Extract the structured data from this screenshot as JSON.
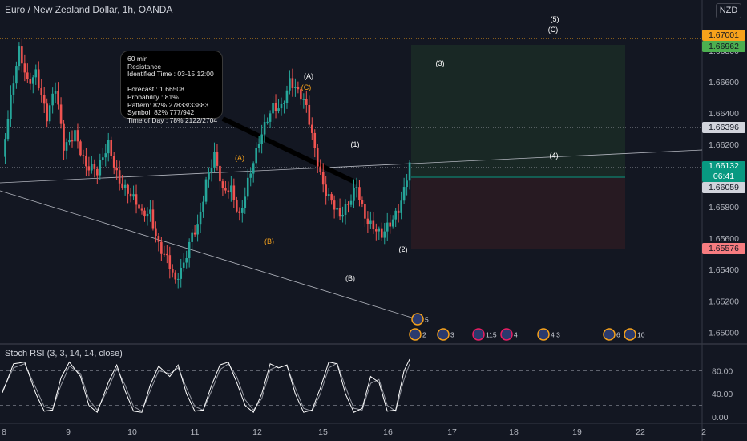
{
  "header": {
    "title": "Euro / New Zealand Dollar, 1h, OANDA",
    "currency": "NZD"
  },
  "tooltip": {
    "lines": [
      "60 min",
      "Resistance",
      "Identified Time : 03-15 12:00",
      "",
      "Forecast : 1.66508",
      "Probability : 81%",
      "Pattern: 82% 27833/33883",
      "Symbol: 82% 777/942",
      "Time of Day : 78% 2122/2704"
    ]
  },
  "price_labels": {
    "orange": "1.67001",
    "green": "1.66962",
    "grey1": "1.66396",
    "current": "1.66132",
    "countdown": "06:41",
    "grey2": "1.66059",
    "red": "1.65576"
  },
  "indicator": {
    "label": "Stoch RSI (3, 3, 14, 14, close)"
  },
  "colors": {
    "background": "#131722",
    "up": "#26a69a",
    "down": "#ef5350",
    "wave_orange": "#f7a21b",
    "wave_white": "#ffffff",
    "target_green": "#1b2a26",
    "target_red": "#2a1b22"
  },
  "chart_data": [
    {
      "type": "candlestick",
      "title": "Euro / New Zealand Dollar, 1h, OANDA",
      "x_ticks": [
        "8",
        "9",
        "10",
        "11",
        "12",
        "15",
        "16",
        "17",
        "18",
        "19",
        "22",
        "2"
      ],
      "y_ticks": [
        "1.66800",
        "1.66600",
        "1.66400",
        "1.66200",
        "1.66000",
        "1.65800",
        "1.65600",
        "1.65400",
        "1.65200",
        "1.65000"
      ],
      "ylim": [
        1.6493,
        1.6705
      ],
      "series": [
        {
          "name": "candles",
          "segments": [
            [
              0,
              1.6612
            ],
            [
              3,
              1.6645
            ],
            [
              6,
              1.6678
            ],
            [
              9,
              1.6662
            ],
            [
              12,
              1.667
            ],
            [
              16,
              1.6635
            ],
            [
              19,
              1.6652
            ],
            [
              22,
              1.6618
            ],
            [
              26,
              1.6632
            ],
            [
              30,
              1.6605
            ],
            [
              34,
              1.6598
            ],
            [
              38,
              1.6622
            ],
            [
              42,
              1.66
            ],
            [
              46,
              1.6585
            ],
            [
              50,
              1.6572
            ],
            [
              53,
              1.6578
            ],
            [
              56,
              1.656
            ],
            [
              59,
              1.6548
            ],
            [
              62,
              1.6528
            ],
            [
              65,
              1.654
            ],
            [
              68,
              1.6565
            ],
            [
              70,
              1.6572
            ],
            [
              73,
              1.6598
            ],
            [
              76,
              1.661
            ],
            [
              79,
              1.6586
            ],
            [
              82,
              1.6592
            ],
            [
              85,
              1.6578
            ],
            [
              88,
              1.6598
            ],
            [
              91,
              1.6612
            ],
            [
              94,
              1.6628
            ],
            [
              97,
              1.6645
            ],
            [
              100,
              1.6648
            ],
            [
              103,
              1.6662
            ],
            [
              106,
              1.665
            ],
            [
              109,
              1.664
            ],
            [
              112,
              1.6618
            ],
            [
              115,
              1.6598
            ],
            [
              118,
              1.6585
            ],
            [
              121,
              1.657
            ],
            [
              124,
              1.6578
            ],
            [
              127,
              1.6595
            ],
            [
              130,
              1.6578
            ],
            [
              133,
              1.6568
            ],
            [
              136,
              1.6558
            ],
            [
              139,
              1.6566
            ],
            [
              142,
              1.658
            ],
            [
              144,
              1.6595
            ],
            [
              146,
              1.6612
            ]
          ]
        }
      ],
      "wave_labels": [
        {
          "text": "(5)",
          "color": "white"
        },
        {
          "text": "(C)",
          "color": "white"
        },
        {
          "text": "(A)",
          "color": "white"
        },
        {
          "text": "(C)",
          "color": "orange"
        },
        {
          "text": "(3)",
          "color": "white"
        },
        {
          "text": "(A)",
          "color": "orange"
        },
        {
          "text": "(1)",
          "color": "white"
        },
        {
          "text": "(4)",
          "color": "white"
        },
        {
          "text": "(B)",
          "color": "orange"
        },
        {
          "text": "(2)",
          "color": "white"
        },
        {
          "text": "(B)",
          "color": "white"
        }
      ],
      "event_badges": [
        "5",
        "2",
        "3",
        "115",
        "4",
        "4 3",
        "6",
        "10"
      ]
    },
    {
      "type": "line",
      "title": "Stoch RSI (3, 3, 14, 14, close)",
      "y_ticks": [
        "80.00",
        "40.00",
        "0.00"
      ],
      "ylim": [
        0,
        100
      ],
      "series": [
        {
          "name": "K",
          "segments": [
            [
              0,
              42
            ],
            [
              4,
              92
            ],
            [
              8,
              95
            ],
            [
              12,
              40
            ],
            [
              15,
              10
            ],
            [
              18,
              12
            ],
            [
              21,
              68
            ],
            [
              24,
              95
            ],
            [
              28,
              70
            ],
            [
              31,
              20
            ],
            [
              34,
              8
            ],
            [
              38,
              60
            ],
            [
              41,
              90
            ],
            [
              44,
              45
            ],
            [
              47,
              10
            ],
            [
              50,
              8
            ],
            [
              53,
              55
            ],
            [
              56,
              88
            ],
            [
              60,
              70
            ],
            [
              63,
              90
            ],
            [
              66,
              40
            ],
            [
              69,
              10
            ],
            [
              72,
              12
            ],
            [
              75,
              55
            ],
            [
              78,
              90
            ],
            [
              81,
              95
            ],
            [
              84,
              60
            ],
            [
              87,
              20
            ],
            [
              90,
              8
            ],
            [
              93,
              40
            ],
            [
              96,
              92
            ],
            [
              99,
              85
            ],
            [
              102,
              90
            ],
            [
              105,
              40
            ],
            [
              108,
              8
            ],
            [
              111,
              12
            ],
            [
              114,
              50
            ],
            [
              117,
              95
            ],
            [
              120,
              92
            ],
            [
              123,
              40
            ],
            [
              126,
              8
            ],
            [
              129,
              15
            ],
            [
              132,
              70
            ],
            [
              135,
              60
            ],
            [
              138,
              10
            ],
            [
              141,
              12
            ],
            [
              144,
              80
            ],
            [
              146,
              100
            ]
          ]
        },
        {
          "name": "D",
          "segments": [
            [
              0,
              45
            ],
            [
              4,
              85
            ],
            [
              8,
              92
            ],
            [
              12,
              50
            ],
            [
              15,
              18
            ],
            [
              18,
              14
            ],
            [
              21,
              55
            ],
            [
              24,
              88
            ],
            [
              28,
              75
            ],
            [
              31,
              30
            ],
            [
              34,
              12
            ],
            [
              38,
              50
            ],
            [
              41,
              84
            ],
            [
              44,
              55
            ],
            [
              47,
              18
            ],
            [
              50,
              10
            ],
            [
              53,
              45
            ],
            [
              56,
              80
            ],
            [
              60,
              75
            ],
            [
              63,
              85
            ],
            [
              66,
              50
            ],
            [
              69,
              18
            ],
            [
              72,
              12
            ],
            [
              75,
              45
            ],
            [
              78,
              82
            ],
            [
              81,
              92
            ],
            [
              84,
              70
            ],
            [
              87,
              30
            ],
            [
              90,
              12
            ],
            [
              93,
              32
            ],
            [
              96,
              82
            ],
            [
              99,
              88
            ],
            [
              102,
              88
            ],
            [
              105,
              50
            ],
            [
              108,
              15
            ],
            [
              111,
              10
            ],
            [
              114,
              40
            ],
            [
              117,
              85
            ],
            [
              120,
              93
            ],
            [
              123,
              52
            ],
            [
              126,
              15
            ],
            [
              129,
              12
            ],
            [
              132,
              58
            ],
            [
              135,
              65
            ],
            [
              138,
              20
            ],
            [
              141,
              10
            ],
            [
              144,
              65
            ],
            [
              146,
              92
            ]
          ]
        }
      ]
    }
  ]
}
